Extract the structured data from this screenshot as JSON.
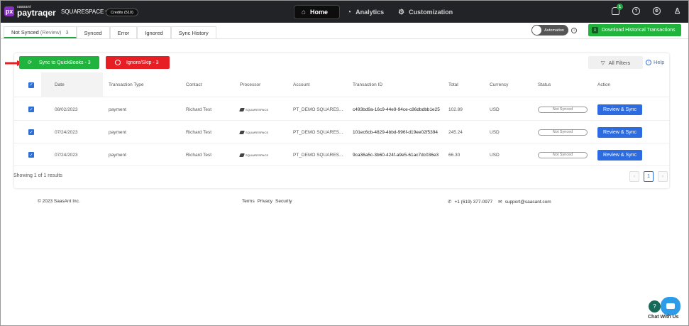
{
  "brand": {
    "small": "saasant",
    "big": "paytraqer",
    "mark": "px"
  },
  "store": {
    "name": "SQUARESPACE",
    "chevron": "▾"
  },
  "credits": "Credits (510)",
  "nav": [
    {
      "label": "Home",
      "icon": "home-icon",
      "glyph": "⌂"
    },
    {
      "label": "Analytics",
      "icon": "chart-icon",
      "glyph": "◔"
    },
    {
      "label": "Customization",
      "icon": "gears-icon",
      "glyph": "⚙"
    }
  ],
  "top_icons": {
    "notif_count": "1",
    "help_glyph": "?",
    "settings_glyph": "⚙",
    "user_glyph": "♙"
  },
  "tabs": [
    {
      "label": "Not Synced",
      "muted": "(Review)",
      "count": "3"
    },
    {
      "label": "Synced"
    },
    {
      "label": "Error"
    },
    {
      "label": "Ignored"
    },
    {
      "label": "Sync History"
    }
  ],
  "automation": {
    "label": "Automation",
    "info": "i"
  },
  "download_label": "Download Historical Transactions",
  "actions": {
    "sync_label": "Sync to QuickBooks - 3",
    "ignore_label": "Ignore/Skip - 3",
    "filters_label": "All Filters",
    "help_label": "Help"
  },
  "table": {
    "columns": [
      "Date",
      "Transaction Type",
      "Contact",
      "Processor",
      "Account",
      "Transaction ID",
      "Total",
      "Currency",
      "Status",
      "Action"
    ],
    "rows": [
      {
        "date": "08/02/2023",
        "type": "payment",
        "contact": "Richard Test",
        "processor": "SQUARESPACE",
        "account": "PT_DEMO SQUARES...",
        "txn_id": "c493bd9a-16c9-44e9-94ce-c86dbdbb1e25",
        "total": "102.89",
        "currency": "USD",
        "status": "Not Synced",
        "action": "Review & Sync"
      },
      {
        "date": "07/24/2023",
        "type": "payment",
        "contact": "Richard Test",
        "processor": "SQUARESPACE",
        "account": "PT_DEMO SQUARES...",
        "txn_id": "101ec6cb-4829-4bbd-996f-d19ee02f5394",
        "total": "245.24",
        "currency": "USD",
        "status": "Not Synced",
        "action": "Review & Sync"
      },
      {
        "date": "07/24/2023",
        "type": "payment",
        "contact": "Richard Test",
        "processor": "SQUARESPACE",
        "account": "PT_DEMO SQUARES...",
        "txn_id": "9ca36a5c-3b60-424f-a9e5-61ac7dc036e3",
        "total": "66.30",
        "currency": "USD",
        "status": "Not Synced",
        "action": "Review & Sync"
      }
    ]
  },
  "showing": "Showing 1 of 1 results",
  "pagination": {
    "prev": "‹",
    "current": "1",
    "next": "›"
  },
  "footer": {
    "copyright": "© 2023 SaasAnt Inc.",
    "links": [
      "Terms",
      "Privacy",
      "Security"
    ],
    "phone": "+1 (619) 377-0977",
    "email": "support@saasant.com"
  },
  "chat_label": "Chat With Us",
  "colors": {
    "green": "#20b33d",
    "red": "#e81e25",
    "blue": "#2d6be0",
    "topbar": "#222326"
  }
}
